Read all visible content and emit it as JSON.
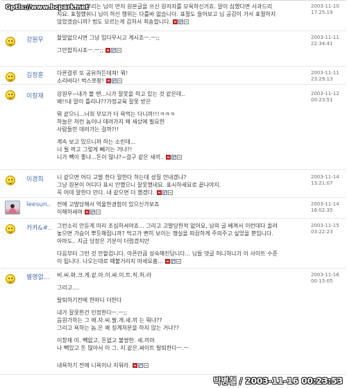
{
  "watermark": "Gptls://www.bcpark.net",
  "signature": "박병철 / 2003-11-16 00:23:53",
  "comments": [
    {
      "author": "",
      "date": "2003-11-10",
      "time": "17:25:19",
      "lines": [
        "그런데 그건 뿌리는 님이 먼저 원본글을 쓰신 원저자를 모욕하신거죠. 말이 심했다면 사과드리",
        "지요. 표절했쉬니 님이 하신 행위는 다를바 없습니다. 표절도 들어보고 님 공감이 가서 표절하지",
        "않았겠습니까? 법도 모르는게 갑처서 죄송합니다."
      ]
    },
    {
      "author": "강원우",
      "date": "2003-11-11",
      "time": "22:34:41",
      "lines": [
        "할말없으시면 그냥 입다무시고 계시죠ㅡ.ㅡ;;",
        "",
        "그만합치시죠ㅡ.ㅡ;;"
      ]
    },
    {
      "author": "김정훈",
      "date": "2003-11-11",
      "time": "23:29:13",
      "lines": [
        "다른걸루 또 공유하든데져! 뭐!",
        "소리바다! 벅스쪼팡!"
      ]
    },
    {
      "author": "이창재",
      "date": "2003-11-12",
      "time": "00:23:51",
      "lines": [
        "강원우~내가 볼 땐...니가 잘못을 하고 있는 것 같은데..",
        "왜!!내 말이 틀리냐??가정교육 잘못 받은",
        "",
        "뭐 같으니...너희 부모가 더 욕먹는 다니까!!!ㅋㅋㅋ",
        "하늘은 저런 놈이나 데려가지 왜 세상에 필요한",
        "사람들만 데려가는 걸까?!!",
        "",
        "계속 보고 있으니까 하는 소린데...",
        "너 될 꺼고 그렇게 빼기는 거냐?!",
        "니가 빽이 좋냐...돈이 많냐?~걸구 같은 새끼.."
      ]
    },
    {
      "author": "이경희",
      "date": "2003-11-14",
      "time": "13:21:07",
      "lines": [
        "니 같으면 어디 고발 한다 말한다 하는데 성질 안내겠냐?",
        "그냥 원본이 어디다 표시 안했으니 잘못했네요. 표시하세요로 끝나야지.",
        "꼭 어데 말한다 만다. 내 같으면 더 했겠다."
      ]
    },
    {
      "author": "leesun..",
      "date": "2003-11-14",
      "time": "16:02:35",
      "lines": [
        "전에 고발당해서 억울한경험이 있으신가보죠",
        "이해하세여"
      ]
    },
    {
      "author": "카카&#..",
      "date": "2003-11-15",
      "time": "03:22:23",
      "lines": [
        "그런소리 안듣게 미리 조심하셔야죠... 그리고 고발당한적 없어요, 남의 글 베껴서 이런데다 올려",
        "놓으면 가슴이 뿌듯해집니까? 먹고가 뻔히 보이는 행실을 따끔하게 주의주고 싶었을 뿐입니다.",
        "아마도.. 지금 당장은 기분이 더럽겠지만",
        "",
        "다음부터 그런 것 안할겁니다. 아픈만큼 성숙해진답니다... 님들 댓글 허니하나가 이 사이트 수준",
        "이 됩니다. 나오는대로 때불거리지 마세요흠..."
      ]
    },
    {
      "author": "별명없...",
      "date": "2003-11-16",
      "time": "00:15:05",
      "lines": [
        "비.씨.파.크.게.같.아.이.싸.이.트.직.허.라",
        "",
        "그리고....",
        "",
        "탈퇴하기전에 한마디 더한다",
        "",
        "내가 잘못한건 인정한다ㅡ.ㅡ;;",
        "음원가하는 그 애.자.씨.팔.개.새.끼 는 뭐냐??",
        "그리고 욕하는 놈.은 왜 징계처분을 하지 않는 거냐??",
        "",
        "이창재 이. 빽없고, 돈없고 불쌍한. 새.끼야.",
        "나 빽있고 돈 많아서 이 그. 지.같은.싸이트 탈퇴한다ㅡ.ㅡ",
        "",
        "",
        "내욕하기 전에 니욕이나 지워라."
      ]
    }
  ]
}
